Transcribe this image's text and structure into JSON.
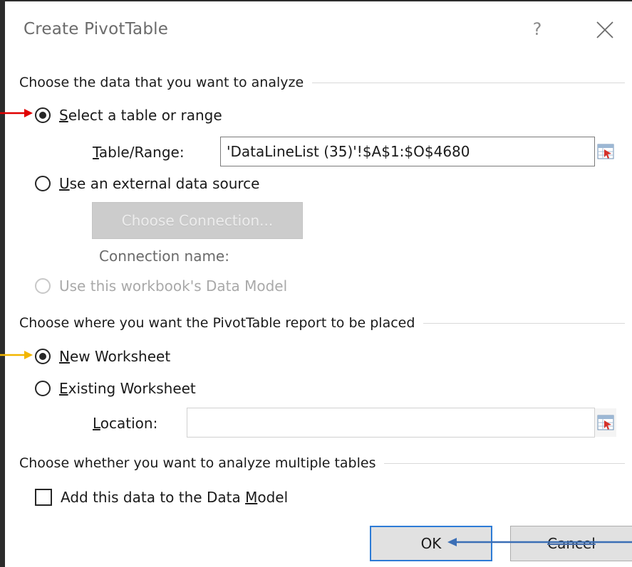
{
  "dialog": {
    "title": "Create PivotTable",
    "help_label": "?",
    "close_icon": "close-icon"
  },
  "data_section": {
    "heading": "Choose the data that you want to analyze",
    "select_table": {
      "label_first": "S",
      "label_rest": "elect a table or range",
      "checked": true
    },
    "table_range": {
      "label_first": "T",
      "label_rest": "able/Range:",
      "value": "'DataLineList (35)'!$A$1:$O$4680"
    },
    "external_source": {
      "label_first": "U",
      "label_rest": "se an external data source",
      "checked": false
    },
    "choose_connection_label": "Choose Connection...",
    "connection_name_label": "Connection name:",
    "data_model_option": {
      "label": "Use this workbook's Data Model",
      "enabled": false
    }
  },
  "placement_section": {
    "heading": "Choose where you want the PivotTable report to be placed",
    "new_worksheet": {
      "label_first": "N",
      "label_rest": "ew Worksheet",
      "checked": true
    },
    "existing_worksheet": {
      "label_first": "E",
      "label_rest": "xisting Worksheet",
      "checked": false
    },
    "location": {
      "label_first": "L",
      "label_rest": "ocation:",
      "value": ""
    }
  },
  "multiple_section": {
    "heading": "Choose whether you want to analyze multiple tables",
    "add_to_model": {
      "label_before": "Add this data to the Data ",
      "label_underlined": "M",
      "label_after": "odel",
      "checked": false
    }
  },
  "buttons": {
    "ok_label": "OK",
    "cancel_label": "Cancel"
  },
  "colors": {
    "arrow_red": "#e00000",
    "arrow_orange": "#f2b600",
    "arrow_blue": "#3b6fb6",
    "default_button_border": "#2d7bd6"
  }
}
